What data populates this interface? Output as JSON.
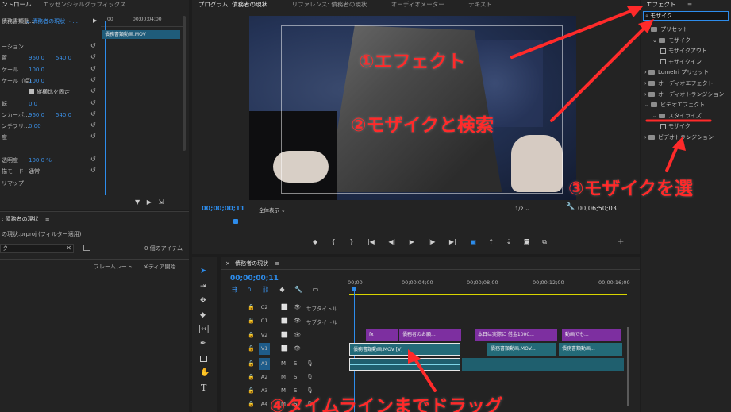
{
  "left_top_tabs": [
    "ントロール",
    "エッセンシャルグラフィックス"
  ],
  "effect_controls": {
    "source_dropdown": "債務書類動...",
    "clip_dropdown": "債務者の現状 ・...",
    "clip_name": "債務書類動画.MOV",
    "ruler_time": "00;00;04;00",
    "ruler_start": "00",
    "rows": [
      {
        "label": "ーション",
        "v1": "",
        "v2": ""
      },
      {
        "label": "置",
        "v1": "960.0",
        "v2": "540.0"
      },
      {
        "label": "ケール",
        "v1": "100.0",
        "v2": ""
      },
      {
        "label": "ケール（幅）",
        "v1": "100.0",
        "v2": ""
      },
      {
        "label": "",
        "v1": "縦横比を固定",
        "v2": ""
      },
      {
        "label": "転",
        "v1": "0.0",
        "v2": ""
      },
      {
        "label": "ンカーポ...",
        "v1": "960.0",
        "v2": "540.0"
      },
      {
        "label": "ンチフリ...",
        "v1": "0.00",
        "v2": ""
      },
      {
        "label": "度",
        "v1": "",
        "v2": ""
      },
      {
        "label": "",
        "v1": "",
        "v2": ""
      },
      {
        "label": "透明度",
        "v1": "100.0 %",
        "v2": ""
      },
      {
        "label": "描モード",
        "v1": "通常",
        "v2": ""
      },
      {
        "label": "リマップ",
        "v1": "",
        "v2": ""
      }
    ]
  },
  "project": {
    "tab": "債務者の現状",
    "path": "の現状.prproj (フィルター適用)",
    "search_value": "ク",
    "item_count": "0 個のアイテム",
    "col_framerate": "フレームレート",
    "col_media": "メディア開始"
  },
  "program": {
    "tabs": [
      "プログラム: 債務者の現状",
      "リファレンス: 債務者の現状",
      "オーディオメーター",
      "テキスト"
    ],
    "timecode": "00;00;00;11",
    "zoom": "全体表示",
    "quality": "1/2",
    "duration": "00;06;50;03"
  },
  "timeline": {
    "tab": "債務者の現状",
    "timecode": "00;00;00;11",
    "ruler": [
      "00;00",
      "00;00;04;00",
      "00;00;08;00",
      "00;00;12;00",
      "00;00;16;00"
    ],
    "tracks": [
      {
        "id": "C2",
        "name": "サブタイトル"
      },
      {
        "id": "C1",
        "name": "サブタイトル"
      },
      {
        "id": "V2",
        "name": ""
      },
      {
        "id": "V1",
        "name": ""
      },
      {
        "id": "A1",
        "name": ""
      },
      {
        "id": "A2",
        "name": ""
      },
      {
        "id": "A3",
        "name": ""
      },
      {
        "id": "A4",
        "name": ""
      }
    ],
    "v2_clips": [
      "債務者のお願...",
      "本日は実際に 借金1000...",
      "動画でも..."
    ],
    "v1_clips": [
      "債務書類動画.MOV [V]",
      "債務書類動画.MOV...",
      "債務書類動画..."
    ]
  },
  "effects": {
    "title": "エフェクト",
    "search_value": "モザイク",
    "tree": [
      {
        "label": "プリセット",
        "level": 0,
        "type": "folder",
        "expanded": true
      },
      {
        "label": "モザイク",
        "level": 1,
        "type": "folder",
        "expanded": true
      },
      {
        "label": "モザイクアウト",
        "level": 2,
        "type": "fx"
      },
      {
        "label": "モザイクイン",
        "level": 2,
        "type": "fx"
      },
      {
        "label": "Lumetri プリセット",
        "level": 0,
        "type": "folder",
        "expanded": false
      },
      {
        "label": "オーディオエフェクト",
        "level": 0,
        "type": "folder",
        "expanded": false
      },
      {
        "label": "オーディオトランジション",
        "level": 0,
        "type": "folder",
        "expanded": false
      },
      {
        "label": "ビデオエフェクト",
        "level": 0,
        "type": "folder",
        "expanded": true
      },
      {
        "label": "スタイライズ",
        "level": 1,
        "type": "folder",
        "expanded": true
      },
      {
        "label": "モザイク",
        "level": 2,
        "type": "fx"
      },
      {
        "label": "ビデオトランジション",
        "level": 0,
        "type": "folder",
        "expanded": false
      }
    ]
  },
  "annotations": {
    "step1": "①エフェクト",
    "step2": "②モザイクと検索",
    "step3": "③モザイクを選",
    "step4": "④タイムラインまでドラッグ"
  },
  "colors": {
    "accent_blue": "#2d8ceb",
    "annotation_red": "#ff2a2a",
    "clip_purple": "#7d2fa0",
    "clip_teal": "#236a78",
    "timeline_yellow": "#d8d400"
  }
}
